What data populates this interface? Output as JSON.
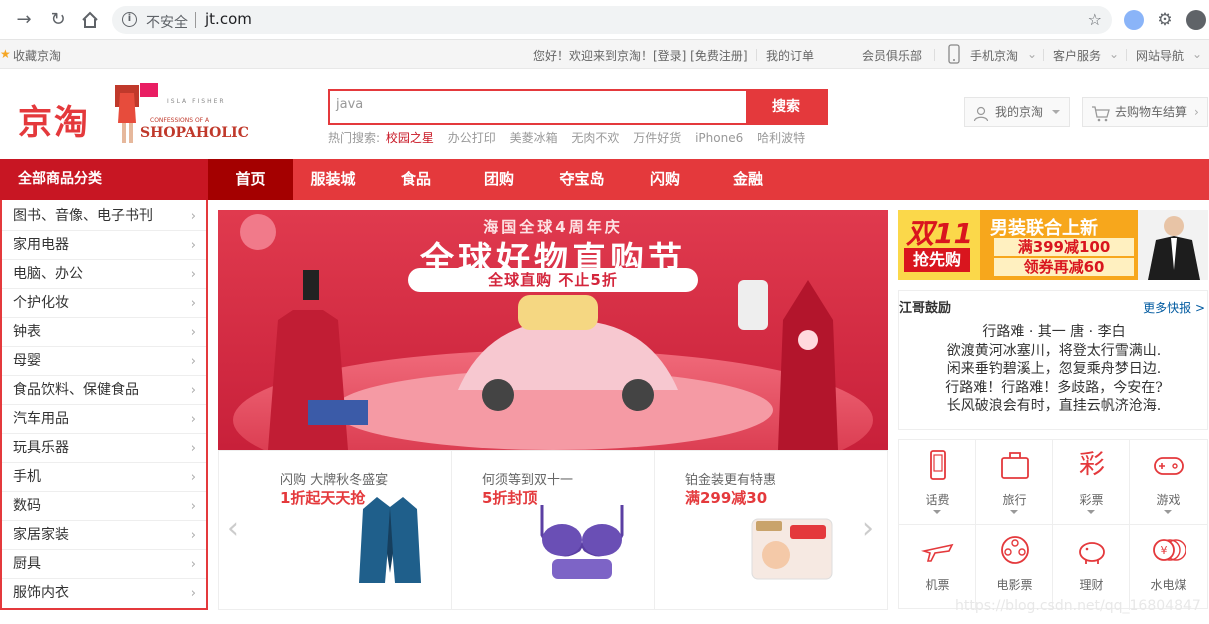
{
  "browser": {
    "insecure_label": "不安全",
    "url": "jt.com"
  },
  "topbar": {
    "bookmark": "收藏京淘",
    "greeting": "您好！欢迎来到京淘！[登录] [免费注册]",
    "my_orders": "我的订单",
    "vip_club": "会员俱乐部",
    "mobile": "手机京淘",
    "customer_service": "客户服务",
    "site_nav": "网站导航"
  },
  "header": {
    "logo_text": "京淘",
    "mini_banner": {
      "author": "ISLA FISHER",
      "line1": "CONFESSIONS OF A",
      "line2": "SHOPAHOLIC"
    },
    "search_value": "java",
    "search_button": "搜索",
    "hot_label": "热门搜索:",
    "hot_terms": [
      "校园之星",
      "办公打印",
      "美菱冰箱",
      "无肉不欢",
      "万件好货",
      "iPhone6",
      "哈利波特"
    ],
    "my_jt": "我的京淘",
    "cart": "去购物车结算"
  },
  "navbar": {
    "all_categories": "全部商品分类",
    "items": [
      "首页",
      "服装城",
      "食品",
      "团购",
      "夺宝岛",
      "闪购",
      "金融"
    ]
  },
  "categories": [
    "图书、音像、电子书刊",
    "家用电器",
    "电脑、办公",
    "个护化妆",
    "钟表",
    "母婴",
    "食品饮料、保健食品",
    "汽车用品",
    "玩具乐器",
    "手机",
    "数码",
    "家居家装",
    "厨具",
    "服饰内衣"
  ],
  "main_banner": {
    "subtitle": "海国全球4周年庆",
    "title": "全球好物直购节",
    "slogan": "全球直购 不止5折"
  },
  "promos": [
    {
      "line1": "闪购  大牌秋冬盛宴",
      "line2": "1折起天天抢"
    },
    {
      "line1": "何须等到双十一",
      "line2": "5折封顶"
    },
    {
      "line1": "铂金装更有特惠",
      "line2": "满299减30"
    }
  ],
  "right_ad": {
    "badge_top": "双11",
    "badge_bottom": "抢先购",
    "title": "男装联合上新",
    "offer1": "满399减100",
    "offer2": "领券再减60"
  },
  "express": {
    "title": "江哥鼓励",
    "more": "更多快报 >",
    "poem": [
      "行路难 · 其一 唐 · 李白",
      "欲渡黄河冰塞川，将登太行雪满山.",
      "闲来垂钓碧溪上，忽复乘舟梦日边.",
      "行路难！行路难！多歧路，今安在?",
      "长风破浪会有时，直挂云帆济沧海."
    ]
  },
  "services": [
    "话费",
    "旅行",
    "彩票",
    "游戏",
    "机票",
    "电影票",
    "理财",
    "水电煤"
  ],
  "watermark": "https://blog.csdn.net/qq_16804847",
  "colors": {
    "brand_red": "#e4393c",
    "dark_red": "#c81623",
    "active_nav": "#a40000"
  }
}
